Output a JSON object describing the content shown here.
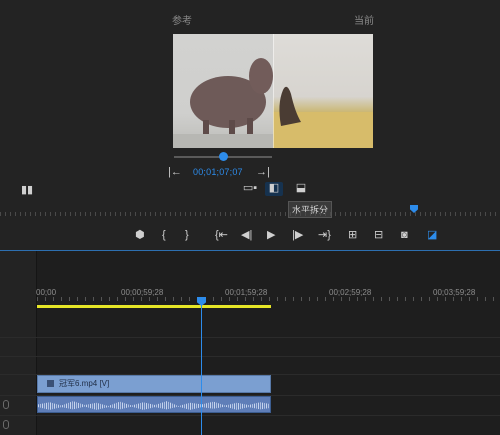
{
  "monitor": {
    "reference_label": "参考",
    "current_label": "当前",
    "timecode": "00;01;07;07"
  },
  "tooltip": "水平拆分",
  "timeline": {
    "ruler": [
      "00;00",
      "00;00;59;28",
      "00;01;59;28",
      "00;02;59;28",
      "00;03;59;28"
    ],
    "clip_label": "冠军6.mp4 [V]"
  },
  "colors": {
    "accent": "#2d8ceb",
    "work_area": "#e6e627",
    "clip": "#7b9fd1"
  }
}
